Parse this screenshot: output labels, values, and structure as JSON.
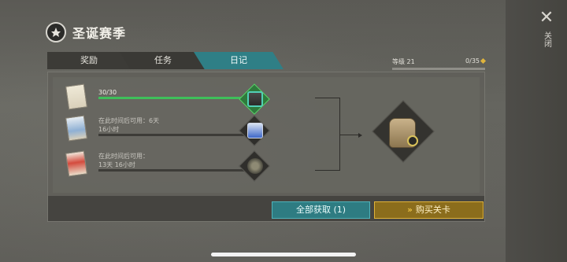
{
  "header": {
    "title": "圣诞赛季",
    "close_label": "关闭"
  },
  "tabs": [
    {
      "label": "奖励",
      "active": false
    },
    {
      "label": "任务",
      "active": false
    },
    {
      "label": "日记",
      "active": true
    }
  ],
  "level": {
    "label": "等级 21",
    "progress_text": "0/35",
    "progress_fraction": 0.0
  },
  "diary_entries": [
    {
      "status": "completed",
      "progress_text": "30/30",
      "progress_fraction": 1.0,
      "item_icon": "toolbox-icon"
    },
    {
      "status": "locked",
      "line1": "在此时间后可用：6天",
      "line2": "16小时",
      "progress_fraction": 0.0,
      "item_icon": "battery-icon"
    },
    {
      "status": "locked",
      "line1": "在此时间后可用：",
      "line2": "13天 16小时",
      "progress_fraction": 0.0,
      "item_icon": "landmine-icon"
    }
  ],
  "final_reward": {
    "icon": "backpack-icon"
  },
  "buttons": {
    "collect_all": "全部获取 (1)",
    "buy_level": "购买关卡"
  },
  "colors": {
    "accent_teal": "#2f7f86",
    "accent_gold": "#e0b33a",
    "progress_green": "#3fbf5a"
  }
}
